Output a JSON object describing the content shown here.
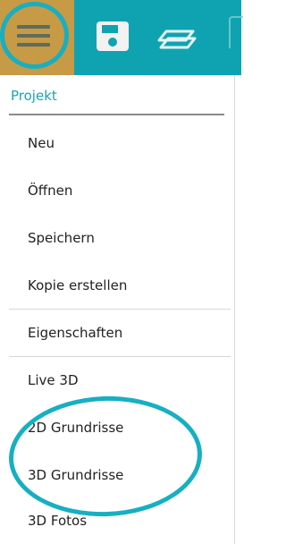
{
  "toolbar": {
    "accent_color": "#0fa3b1",
    "hamburger_icon": "hamburger-menu-icon",
    "save_icon": "floppy-save-icon",
    "layers_icon": "layers-icon"
  },
  "menu": {
    "section_title": "Projekt",
    "items": [
      {
        "label": "Neu"
      },
      {
        "label": "Öffnen"
      },
      {
        "label": "Speichern"
      },
      {
        "label": "Kopie erstellen"
      },
      {
        "label": "Eigenschaften"
      },
      {
        "label": "Live 3D"
      },
      {
        "label": "2D Grundrisse"
      },
      {
        "label": "3D Grundrisse"
      },
      {
        "label": "3D Fotos"
      }
    ]
  },
  "annotation_color": "#17afc2"
}
